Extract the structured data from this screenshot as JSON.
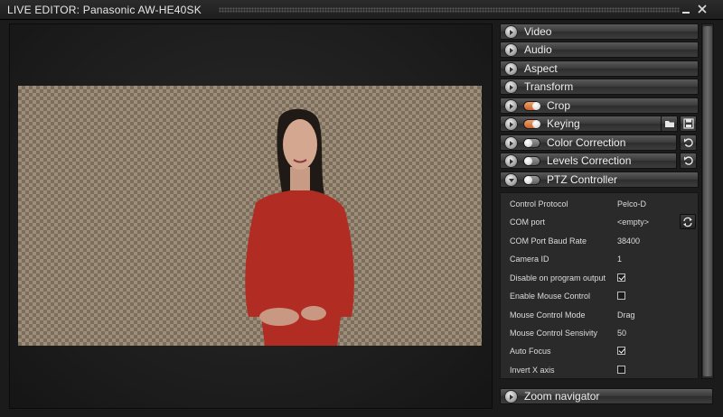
{
  "window": {
    "title": "LIVE EDITOR: Panasonic AW-HE40SK"
  },
  "sections": [
    {
      "label": "Video",
      "expanded": false,
      "toggle": null
    },
    {
      "label": "Audio",
      "expanded": false,
      "toggle": null
    },
    {
      "label": "Aspect",
      "expanded": false,
      "toggle": null
    },
    {
      "label": "Transform",
      "expanded": false,
      "toggle": null
    },
    {
      "label": "Crop",
      "expanded": false,
      "toggle": "on"
    },
    {
      "label": "Keying",
      "expanded": false,
      "toggle": "on"
    },
    {
      "label": "Color Correction",
      "expanded": false,
      "toggle": "off"
    },
    {
      "label": "Levels Correction",
      "expanded": false,
      "toggle": "off"
    },
    {
      "label": "PTZ Controller",
      "expanded": true,
      "toggle": "off"
    }
  ],
  "ptz": {
    "properties": [
      {
        "name": "Control Protocol",
        "value": "Pelco-D"
      },
      {
        "name": "COM port",
        "value": "<empty>"
      },
      {
        "name": "COM Port Baud Rate",
        "value": "38400"
      },
      {
        "name": "Camera ID",
        "value": "1"
      },
      {
        "name": "Disable on program output",
        "checked": true
      },
      {
        "name": "Enable Mouse Control",
        "checked": false
      },
      {
        "name": "Mouse Control Mode",
        "value": "Drag"
      },
      {
        "name": "Mouse Control Sensivity",
        "value": "50"
      },
      {
        "name": "Auto Focus",
        "checked": true
      },
      {
        "name": "Invert X axis",
        "checked": false
      }
    ]
  },
  "zoom_navigator": {
    "label": "Zoom navigator"
  },
  "colors": {
    "toggle_on": "#e07a3e",
    "background": "#1b1b1b",
    "checker_dark": "#7c6e5e",
    "checker_light": "#9e8e78"
  }
}
